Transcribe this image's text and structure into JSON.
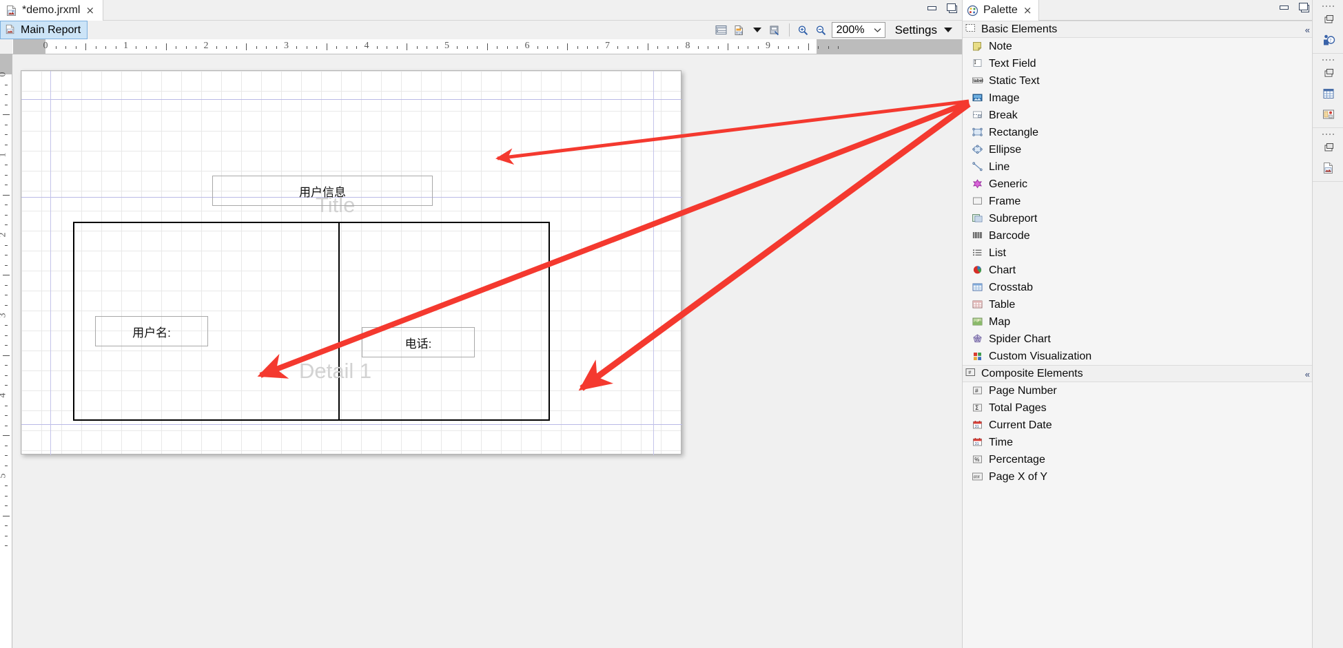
{
  "window": {
    "file_tab": {
      "label": "*demo.jrxml",
      "icon": "jrxml-file-icon",
      "close": "×"
    },
    "minimize_icon": "minimize-icon",
    "maximize_icon": "maximize-restore-icon"
  },
  "editor": {
    "report_tab": {
      "label": "Main Report",
      "icon": "report-icon"
    },
    "toolbar": {
      "items": [
        {
          "name": "band-view-icon",
          "label": ""
        },
        {
          "name": "data-source-icon",
          "label": ""
        },
        {
          "name": "dropdown-caret-icon",
          "label": ""
        },
        {
          "name": "preview-icon",
          "label": ""
        }
      ],
      "zoom_in_icon": "zoom-in-icon",
      "zoom_out_icon": "zoom-out-icon",
      "zoom_value": "200%",
      "zoom_caret": "chevron-down-icon",
      "settings_label": "Settings",
      "settings_caret": "caret-down-icon"
    },
    "ruler": {
      "horizontal_labels": [
        "0",
        "1",
        "2",
        "3",
        "4",
        "5",
        "6",
        "7",
        "8",
        "9"
      ],
      "vertical_labels": [
        "0",
        "1",
        "2",
        "3",
        "4",
        "5"
      ],
      "unit": "inches"
    },
    "report": {
      "bands": [
        {
          "name": "title",
          "watermark": "Title"
        },
        {
          "name": "detail1",
          "watermark": "Detail 1"
        }
      ],
      "elements": [
        {
          "name": "title-static-text",
          "text": "用户信息"
        },
        {
          "name": "username-static-text",
          "text": "用户名:"
        },
        {
          "name": "phone-static-text",
          "text": "电话:"
        }
      ]
    }
  },
  "palette": {
    "tab": {
      "label": "Palette",
      "icon": "palette-icon",
      "close": "×"
    },
    "minimize_icon": "minimize-icon",
    "maximize_icon": "maximize-restore-icon",
    "sections": [
      {
        "title": "Basic Elements",
        "icon": "basic-elements-icon",
        "collapse": "«",
        "items": [
          {
            "label": "Note",
            "icon": "note-icon"
          },
          {
            "label": "Text Field",
            "icon": "text-field-icon"
          },
          {
            "label": "Static Text",
            "icon": "static-text-icon"
          },
          {
            "label": "Image",
            "icon": "image-icon"
          },
          {
            "label": "Break",
            "icon": "break-icon"
          },
          {
            "label": "Rectangle",
            "icon": "rectangle-icon"
          },
          {
            "label": "Ellipse",
            "icon": "ellipse-icon"
          },
          {
            "label": "Line",
            "icon": "line-icon"
          },
          {
            "label": "Generic",
            "icon": "generic-icon"
          },
          {
            "label": "Frame",
            "icon": "frame-icon"
          },
          {
            "label": "Subreport",
            "icon": "subreport-icon"
          },
          {
            "label": "Barcode",
            "icon": "barcode-icon"
          },
          {
            "label": "List",
            "icon": "list-icon"
          },
          {
            "label": "Chart",
            "icon": "chart-icon"
          },
          {
            "label": "Crosstab",
            "icon": "crosstab-icon"
          },
          {
            "label": "Table",
            "icon": "table-icon"
          },
          {
            "label": "Map",
            "icon": "map-icon"
          },
          {
            "label": "Spider Chart",
            "icon": "spider-chart-icon"
          },
          {
            "label": "Custom Visualization",
            "icon": "custom-visualization-icon"
          }
        ]
      },
      {
        "title": "Composite Elements",
        "icon": "composite-elements-icon",
        "collapse": "«",
        "items": [
          {
            "label": "Page Number",
            "icon": "page-number-icon"
          },
          {
            "label": "Total Pages",
            "icon": "total-pages-icon"
          },
          {
            "label": "Current Date",
            "icon": "current-date-icon"
          },
          {
            "label": "Time",
            "icon": "time-icon"
          },
          {
            "label": "Percentage",
            "icon": "percentage-icon"
          },
          {
            "label": "Page X of Y",
            "icon": "page-x-of-y-icon"
          }
        ]
      }
    ]
  },
  "edgebar": {
    "groups": [
      {
        "items": [
          {
            "icon": "restore-view-icon"
          },
          {
            "icon": "outline-person-icon"
          }
        ]
      },
      {
        "items": [
          {
            "icon": "restore-view-icon"
          },
          {
            "icon": "report-inspector-icon"
          },
          {
            "icon": "properties-icon"
          }
        ]
      },
      {
        "items": [
          {
            "icon": "restore-view-icon"
          },
          {
            "icon": "jrxml-file-icon"
          }
        ]
      }
    ]
  },
  "annotations": {
    "arrow_color": "#f4392f",
    "arrows": [
      {
        "from": "static-text-palette-item",
        "to": "title-static-text"
      },
      {
        "from": "static-text-palette-item",
        "to": "username-static-text"
      },
      {
        "from": "static-text-palette-item",
        "to": "phone-static-text"
      }
    ]
  },
  "colors": {
    "accent": "#cce4f7",
    "arrow": "#f4392f",
    "guide": "#c3c3ea",
    "watermark": "#d2d2d2"
  }
}
